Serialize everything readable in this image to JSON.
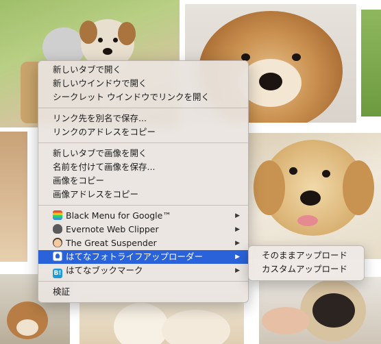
{
  "colors": {
    "highlight": "#2a62d9",
    "menu_background": "#eae4e0",
    "menu_text": "#1a1a1a"
  },
  "context_menu": {
    "groups": [
      {
        "items": [
          {
            "label": "新しいタブで開く"
          },
          {
            "label": "新しいウインドウで開く"
          },
          {
            "label": "シークレット ウインドウでリンクを開く"
          }
        ]
      },
      {
        "items": [
          {
            "label": "リンク先を別名で保存..."
          },
          {
            "label": "リンクのアドレスをコピー"
          }
        ]
      },
      {
        "items": [
          {
            "label": "新しいタブで画像を開く"
          },
          {
            "label": "名前を付けて画像を保存..."
          },
          {
            "label": "画像をコピー"
          },
          {
            "label": "画像アドレスをコピー"
          }
        ]
      },
      {
        "extensions": [
          {
            "label": "Black Menu for Google™",
            "icon": "black-menu-icon",
            "has_submenu": true
          },
          {
            "label": "Evernote Web Clipper",
            "icon": "evernote-elephant-icon",
            "has_submenu": true
          },
          {
            "label": "The Great Suspender",
            "icon": "great-suspender-face-icon",
            "has_submenu": true
          },
          {
            "label": "はてなフォトライフアップローダー",
            "icon": "hatena-fotolife-icon",
            "has_submenu": true,
            "highlighted": true
          },
          {
            "label": "はてなブックマーク",
            "icon": "hatena-bookmark-icon",
            "has_submenu": true
          }
        ]
      },
      {
        "items": [
          {
            "label": "検証"
          }
        ]
      }
    ]
  },
  "submenu": {
    "items": [
      {
        "label": "そのままアップロード"
      },
      {
        "label": "カスタムアップロード"
      }
    ]
  },
  "icons": {
    "submenu_arrow": "▶"
  }
}
